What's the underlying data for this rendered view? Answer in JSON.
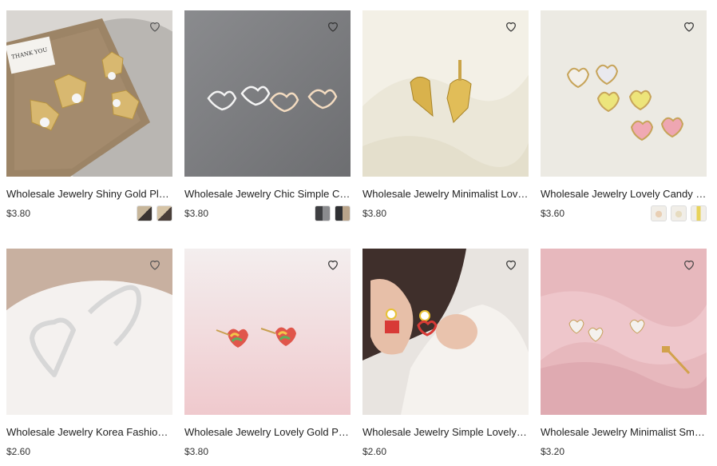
{
  "products": [
    {
      "title": "Wholesale Jewelry Shiny Gold Plate...",
      "price": "$3.80",
      "swatches": 2,
      "card_text": "THANK YOU"
    },
    {
      "title": "Wholesale Jewelry Chic Simple Cubi...",
      "price": "$3.80",
      "swatches": 2
    },
    {
      "title": "Wholesale Jewelry Minimalist Lovel...",
      "price": "$3.80",
      "swatches": 0
    },
    {
      "title": "Wholesale Jewelry Lovely Candy Re...",
      "price": "$3.60",
      "swatches": 3
    },
    {
      "title": "Wholesale Jewelry Korea Fashion H...",
      "price": "$2.60",
      "swatches": 0
    },
    {
      "title": "Wholesale Jewelry Lovely Gold Plat...",
      "price": "$3.80",
      "swatches": 0
    },
    {
      "title": "Wholesale Jewelry Simple Lovely Fl...",
      "price": "$2.60",
      "swatches": 0
    },
    {
      "title": "Wholesale Jewelry Minimalist Small ...",
      "price": "$3.20",
      "swatches": 0
    }
  ],
  "icons": {
    "wishlist": "heart-outline-icon"
  }
}
